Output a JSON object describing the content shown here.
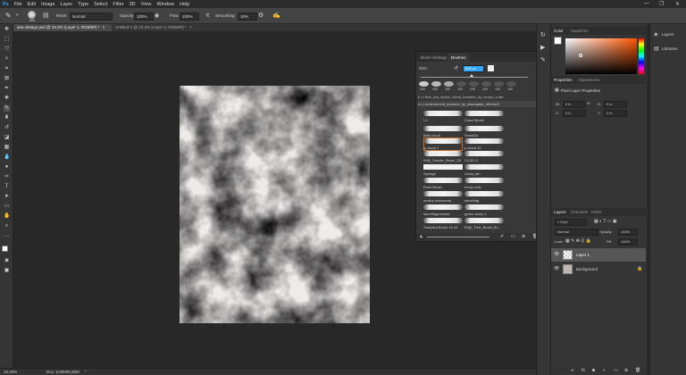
{
  "menu": {
    "logo": "Ps",
    "items": [
      "File",
      "Edit",
      "Image",
      "Layer",
      "Type",
      "Select",
      "Filter",
      "3D",
      "View",
      "Window",
      "Help"
    ],
    "window_controls": [
      "—",
      "❐",
      "✕"
    ]
  },
  "options": {
    "brush_size": "600",
    "mode_label": "Mode:",
    "mode_value": "Normal",
    "opacity_label": "Opacity:",
    "opacity_value": "100%",
    "flow_label": "Flow:",
    "flow_value": "100%",
    "smoothing_label": "Smoothing:",
    "smoothing_value": "10%"
  },
  "tabs": [
    {
      "label": "ana vietago.psd @ 33,3% (Layer 1, RGB/8#) *",
      "close": "×"
    },
    {
      "label": "Untitled-1 @ 33,3% (Layer 2, RGB/8#) *",
      "close": "×"
    }
  ],
  "status": {
    "zoom": "33,33%",
    "doc": "Doc: 5,60M/5,90M"
  },
  "brush_panel": {
    "tabs": [
      "Brush Settings",
      "Brushes"
    ],
    "size_label": "Size:",
    "size_value": "600 px",
    "preset_sizes": [
      "100",
      "400",
      "250",
      "100",
      "100",
      "100",
      "100",
      "100"
    ],
    "folder_top": "free_low_action_blend_brushes_by_vmsyn_s.abr",
    "folder": "environment_brushes_by_dawnpaler_d5uhbc3",
    "items": [
      {
        "name": "i-3"
      },
      {
        "name": "Cloud Brush"
      },
      {
        "name": "fluffy cloud"
      },
      {
        "name": "SmokDs"
      },
      {
        "name": "p cloud 7"
      },
      {
        "name": "p cloud 10"
      },
      {
        "name": "IH@_Smoke_Brush_05"
      },
      {
        "name": "CLOD 3"
      },
      {
        "name": "Sponge"
      },
      {
        "name": "Linda_fan"
      },
      {
        "name": "Rock Brush"
      },
      {
        "name": "frenly rock"
      },
      {
        "name": "mushy stonework"
      },
      {
        "name": "stoneflag"
      },
      {
        "name": "stoneflagreverse"
      },
      {
        "name": "grass clump 1"
      },
      {
        "name": "Sampled Brush 16 42"
      },
      {
        "name": "IH@_Tree_Brush_fin..."
      }
    ]
  },
  "color_panel": {
    "tabs": [
      "Color",
      "Swatches"
    ]
  },
  "properties_panel": {
    "tabs": [
      "Properties",
      "Adjustments"
    ],
    "title": "Pixel Layer Properties",
    "w_label": "W:",
    "w_value": "0 in",
    "h_label": "H:",
    "h_value": "0 in",
    "x_label": "X:",
    "x_value": "0 in",
    "y_label": "Y:",
    "y_value": "0 in"
  },
  "layers_panel": {
    "tabs": [
      "Layers",
      "Channels",
      "Paths"
    ],
    "kind": "Kind",
    "blend": "Normal",
    "opacity_label": "Opacity:",
    "opacity_value": "100%",
    "lock_label": "Lock:",
    "fill_label": "Fill:",
    "fill_value": "100%",
    "layers": [
      {
        "name": "Layer 1",
        "selected": true
      },
      {
        "name": "Background",
        "selected": false
      }
    ]
  },
  "right_dock": {
    "items": [
      {
        "label": "Layers"
      },
      {
        "label": "Libraries"
      }
    ]
  },
  "colors": {
    "accent": "#31a8ff",
    "panel": "#383838",
    "canvas": "#282828"
  }
}
